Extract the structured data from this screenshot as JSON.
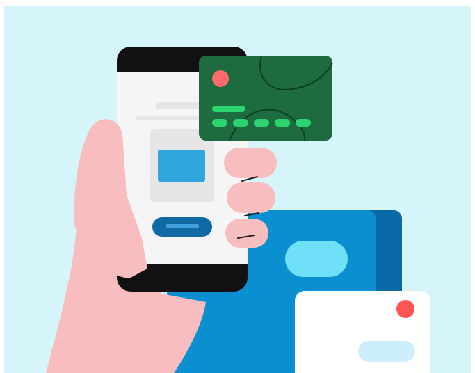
{
  "colors": {
    "background": "#d6f5fb",
    "frame": "#ffffff",
    "hand": "#f8bdbf",
    "hand_line": "#222222",
    "phone_body": "#111111",
    "phone_screen": "#f5f5f5",
    "screen_placeholder": "#e6e6e6",
    "screen_card": "#2fa7de",
    "screen_button": "#0f6aa3",
    "screen_button_highlight": "#3fa0dd",
    "credit_card": "#1d6b3f",
    "credit_card_lines": "#0f3d22",
    "credit_card_chip": "#ff6b6b",
    "credit_card_digits": "#2bd46e",
    "wallet_main": "#0a8fd0",
    "wallet_dark": "#0a6aa8",
    "wallet_pill": "#6fe0f6",
    "note_card": "#ffffff",
    "note_dot": "#ff5555",
    "note_pill": "#cdeffc"
  },
  "icons": {
    "hand": "hand-icon",
    "phone": "smartphone-icon",
    "credit_card": "credit-card-icon",
    "wallet": "wallet-icon",
    "card": "card-icon"
  }
}
